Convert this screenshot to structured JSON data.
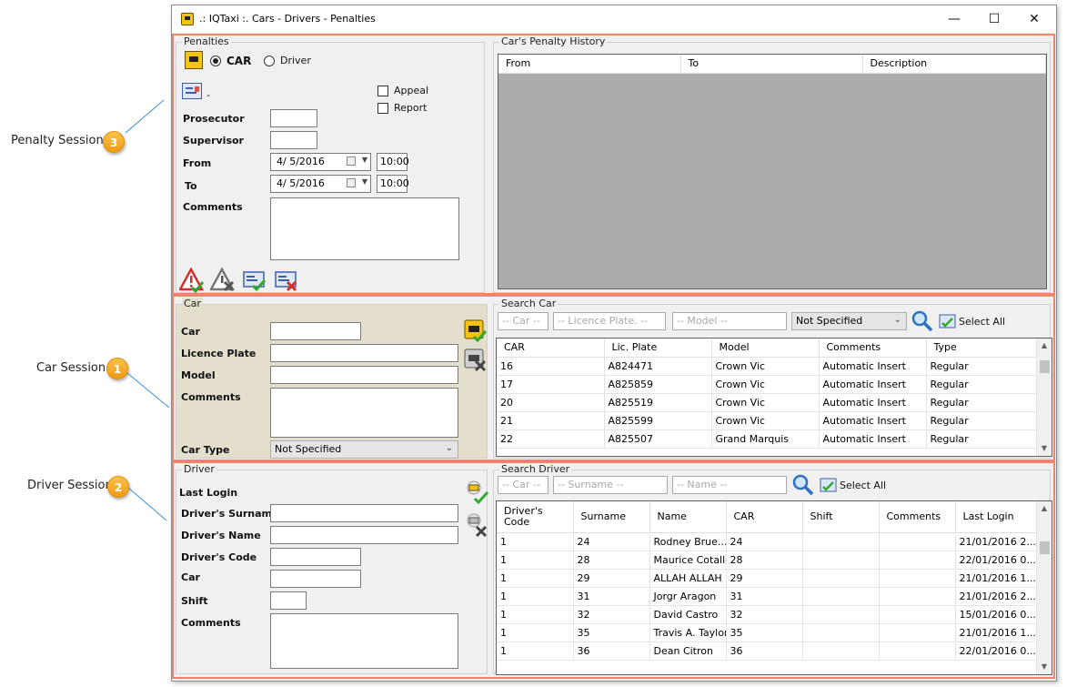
{
  "callouts": {
    "penalty": {
      "label": "Penalty Session",
      "number": "3"
    },
    "car": {
      "label": "Car Session",
      "number": "1"
    },
    "driver": {
      "label": "Driver Session",
      "number": "2"
    }
  },
  "window": {
    "title": ".: IQTaxi :.  Cars - Drivers - Penalties",
    "minimize": "—",
    "maximize": "☐",
    "close": "✕"
  },
  "penalties": {
    "group_title": "Penalties",
    "radio_car": "CAR",
    "radio_driver": "Driver",
    "selected": "CAR",
    "dash": "-",
    "appeal": "Appeal",
    "report": "Report",
    "prosecutor_label": "Prosecutor",
    "supervisor_label": "Supervisor",
    "from_label": "From",
    "to_label": "To",
    "comments_label": "Comments",
    "from_date": "4/  5/2016",
    "from_time": "10:00",
    "to_date": "4/  5/2016",
    "to_time": "10:00"
  },
  "history": {
    "group_title": "Car's Penalty History",
    "columns": [
      "From",
      "To",
      "Description"
    ]
  },
  "car": {
    "group_title": "Car",
    "car_label": "Car",
    "plate_label": "Licence Plate",
    "model_label": "Model",
    "comments_label": "Comments",
    "type_label": "Car Type",
    "type_value": "Not Specified"
  },
  "search_car": {
    "group_title": "Search Car",
    "car_placeholder": "-- Car --",
    "plate_placeholder": "-- Licence Plate. --",
    "model_placeholder": "-- Model --",
    "type_value": "Not Specified",
    "select_all": "Select All",
    "columns": [
      "CAR",
      "Lic. Plate",
      "Model",
      "Comments",
      "Type"
    ],
    "rows": [
      [
        "16",
        "A824471",
        "Crown Vic",
        "Automatic Insert",
        "Regular"
      ],
      [
        "17",
        "A825859",
        "Crown Vic",
        "Automatic Insert",
        "Regular"
      ],
      [
        "20",
        "A825519",
        "Crown Vic",
        "Automatic Insert",
        "Regular"
      ],
      [
        "21",
        "A825599",
        " Crown Vic",
        "Automatic Insert",
        "Regular"
      ],
      [
        "22",
        "A825507",
        "Grand Marquis",
        "Automatic Insert",
        "Regular"
      ]
    ]
  },
  "driver": {
    "group_title": "Driver",
    "last_login_label": "Last Login",
    "surname_label": "Driver's Surname",
    "name_label": "Driver's Name",
    "code_label": "Driver's Code",
    "car_label": "Car",
    "shift_label": "Shift",
    "comments_label": "Comments"
  },
  "search_driver": {
    "group_title": "Search Driver",
    "car_placeholder": "-- Car --",
    "surname_placeholder": "-- Surname --",
    "name_placeholder": "-- Name --",
    "select_all": "Select All",
    "columns": [
      "Driver's Code",
      "Surname",
      "Name",
      "CAR",
      "Shift",
      "Comments",
      "Last Login"
    ],
    "rows": [
      [
        "1",
        "24",
        "Rodney Brue...",
        "24",
        "",
        "",
        "21/01/2016 2..."
      ],
      [
        "1",
        "28",
        "Maurice Cotalle",
        "28",
        "",
        "",
        "22/01/2016 0..."
      ],
      [
        "1",
        "29",
        "ALLAH ALLAH",
        "29",
        "",
        "",
        "21/01/2016 1..."
      ],
      [
        "1",
        "31",
        "Jorgr Aragon",
        "31",
        "",
        "",
        "21/01/2016 2..."
      ],
      [
        "1",
        "32",
        "David Castro",
        "32",
        "",
        "",
        "15/01/2016 0..."
      ],
      [
        "1",
        "35",
        "Travis A. Taylor",
        "35",
        "",
        "",
        "21/01/2016 1..."
      ],
      [
        "1",
        "36",
        "Dean Citron",
        "36",
        "",
        "",
        "22/01/2016 0..."
      ]
    ]
  },
  "icons": [
    "taxi-icon",
    "penalty-card-icon",
    "calendar-icon",
    "search-icon",
    "select-all-icon",
    "add-penalty-icon",
    "remove-penalty-icon",
    "approve-penalty-icon",
    "reject-penalty-icon",
    "car-select-icon",
    "car-clear-icon",
    "driver-select-icon",
    "driver-clear-icon"
  ],
  "colors": {
    "callout_badge": "#f5a623",
    "panel_border": "#f0846b",
    "car_panel_bg": "#e3dfcc",
    "history_bg": "#ababab"
  }
}
